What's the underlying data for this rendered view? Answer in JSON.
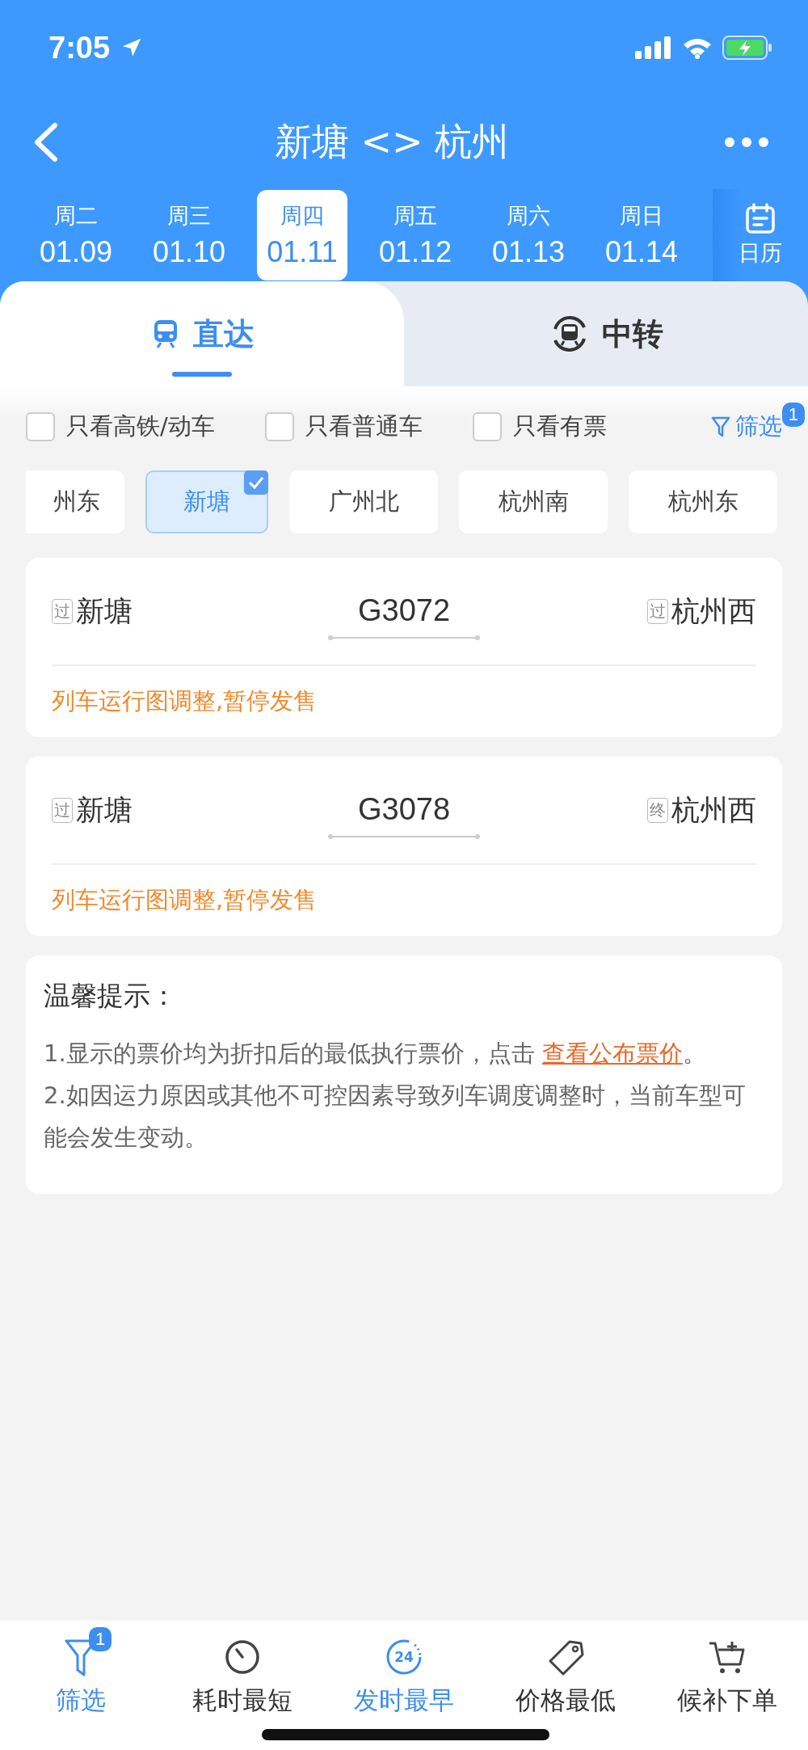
{
  "status_bar": {
    "time": "7:05"
  },
  "header": {
    "title": "新塘 <> 杭州"
  },
  "dates": [
    {
      "weekday": "周二",
      "date": "01.09",
      "selected": false
    },
    {
      "weekday": "周三",
      "date": "01.10",
      "selected": false
    },
    {
      "weekday": "周四",
      "date": "01.11",
      "selected": true
    },
    {
      "weekday": "周五",
      "date": "01.12",
      "selected": false
    },
    {
      "weekday": "周六",
      "date": "01.13",
      "selected": false
    },
    {
      "weekday": "周日",
      "date": "01.14",
      "selected": false
    }
  ],
  "calendar_button": {
    "label": "日历"
  },
  "tabs": [
    {
      "label": "直达",
      "kind": "direct",
      "selected": true
    },
    {
      "label": "中转",
      "kind": "transfer",
      "selected": false
    }
  ],
  "filters": [
    {
      "label": "只看高铁/动车",
      "checked": false
    },
    {
      "label": "只看普通车",
      "checked": false
    },
    {
      "label": "只看有票",
      "checked": false
    }
  ],
  "filter_button": {
    "label": "筛选",
    "badge": "1"
  },
  "stations": [
    {
      "label": "州东",
      "selected": false
    },
    {
      "label": "新塘",
      "selected": true
    },
    {
      "label": "广州北",
      "selected": false
    },
    {
      "label": "杭州南",
      "selected": false
    },
    {
      "label": "杭州东",
      "selected": false
    }
  ],
  "trains": [
    {
      "from_tag": "过",
      "from": "新塘",
      "number": "G3072",
      "to_tag": "过",
      "to": "杭州西",
      "notice": "列车运行图调整,暂停发售"
    },
    {
      "from_tag": "过",
      "from": "新塘",
      "number": "G3078",
      "to_tag": "终",
      "to": "杭州西",
      "notice": "列车运行图调整,暂停发售"
    }
  ],
  "tips": {
    "title": "温馨提示：",
    "line_1": "1.显示的票价均为折扣后的最低执行票价，点击 ",
    "link": "查看公布票价",
    "line_1_end": "。",
    "line_2": "2.如因运力原因或其他不可控因素导致列车调度调整时，当前车型可能会发生变动。"
  },
  "bottom_bar": [
    {
      "label": "筛选",
      "kind": "filter",
      "badge": "1",
      "selected": true
    },
    {
      "label": "耗时最短",
      "kind": "timer",
      "selected": false
    },
    {
      "label": "发时最早",
      "kind": "clock",
      "icon_label": "24",
      "selected": true
    },
    {
      "label": "价格最低",
      "kind": "tag",
      "selected": false
    },
    {
      "label": "候补下单",
      "kind": "cart",
      "selected": false
    }
  ]
}
